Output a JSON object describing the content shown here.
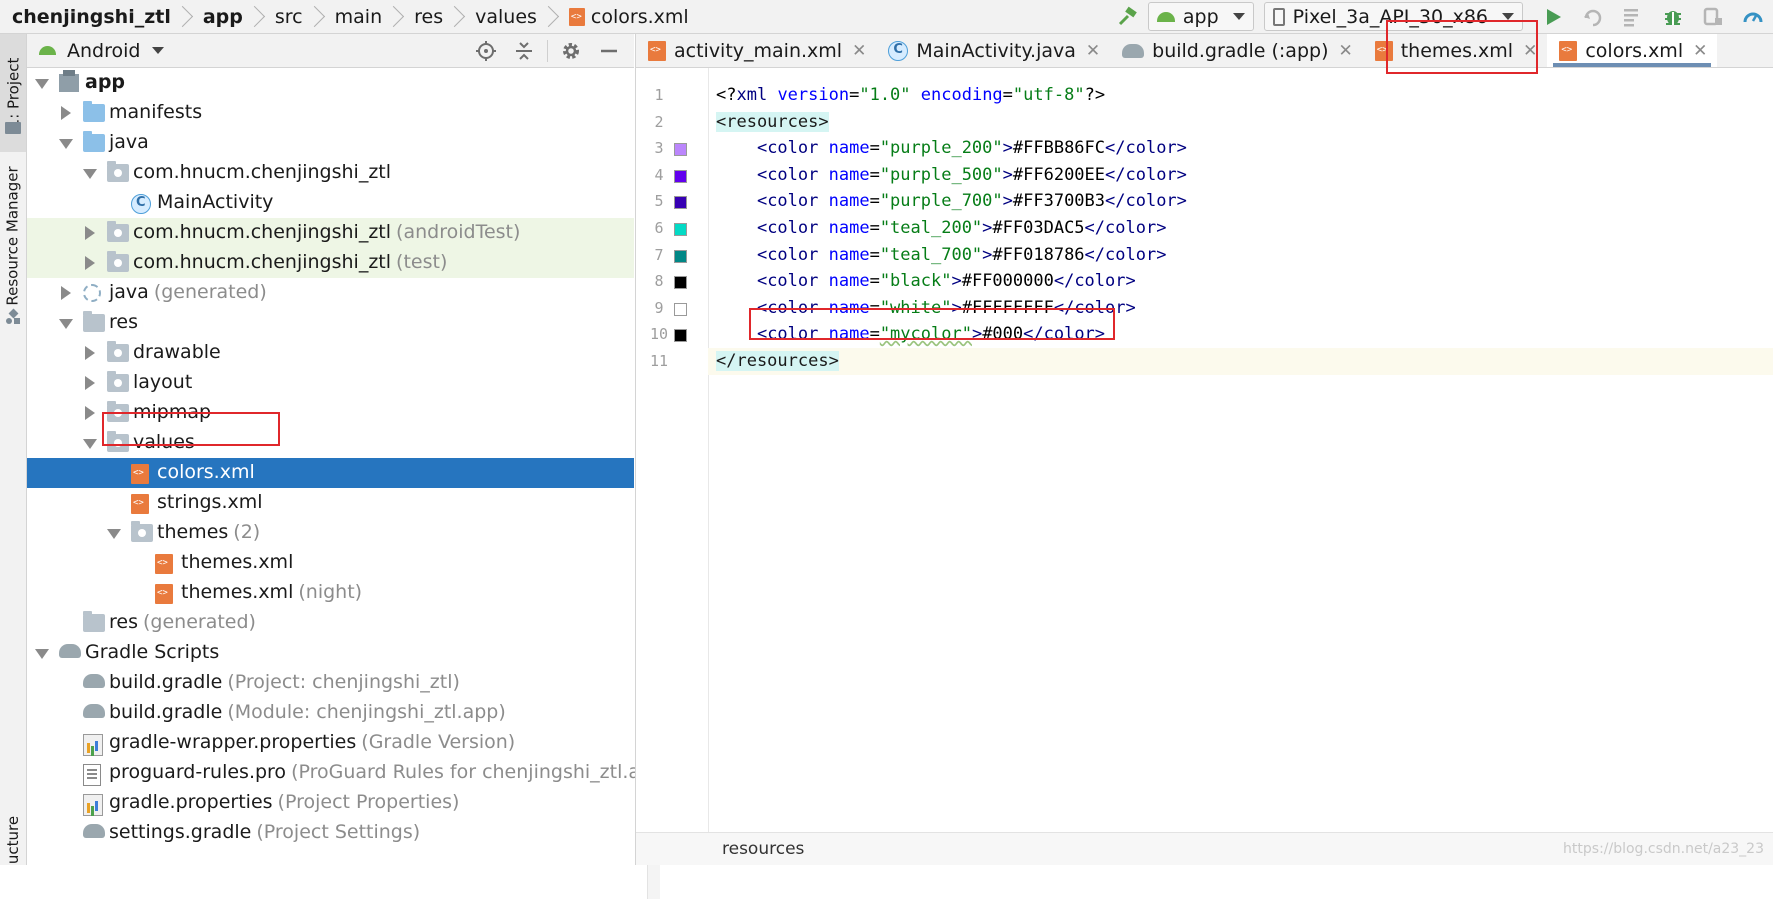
{
  "navbar": {
    "breadcrumbs": [
      "chenjingshi_ztl",
      "app",
      "src",
      "main",
      "res",
      "values",
      "colors.xml"
    ],
    "run_config": "app",
    "device": "Pixel_3a_API_30_x86"
  },
  "left_toolbar": {
    "tabs": [
      "1: Project",
      "Resource Manager",
      "ucture"
    ]
  },
  "project_panel": {
    "view_mode": "Android",
    "tree": [
      {
        "label": "app",
        "hint": "",
        "depth": 0,
        "toggle": "open",
        "icon": "module-icon",
        "bold": true
      },
      {
        "label": "manifests",
        "hint": "",
        "depth": 1,
        "toggle": "closed",
        "icon": "folder-icon"
      },
      {
        "label": "java",
        "hint": "",
        "depth": 1,
        "toggle": "open",
        "icon": "folder-icon"
      },
      {
        "label": "com.hnucm.chenjingshi_ztl",
        "hint": "",
        "depth": 2,
        "toggle": "open",
        "icon": "package-icon"
      },
      {
        "label": "MainActivity",
        "hint": "",
        "depth": 3,
        "toggle": "none",
        "icon": "class-icon"
      },
      {
        "label": "com.hnucm.chenjingshi_ztl",
        "hint": "(androidTest)",
        "depth": 2,
        "toggle": "closed",
        "icon": "package-icon",
        "green": true
      },
      {
        "label": "com.hnucm.chenjingshi_ztl",
        "hint": "(test)",
        "depth": 2,
        "toggle": "closed",
        "icon": "package-icon",
        "green": true
      },
      {
        "label": "java",
        "hint": "(generated)",
        "depth": 1,
        "toggle": "closed",
        "icon": "generated-icon"
      },
      {
        "label": "res",
        "hint": "",
        "depth": 1,
        "toggle": "open",
        "icon": "res-folder-icon"
      },
      {
        "label": "drawable",
        "hint": "",
        "depth": 2,
        "toggle": "closed",
        "icon": "package-icon"
      },
      {
        "label": "layout",
        "hint": "",
        "depth": 2,
        "toggle": "closed",
        "icon": "package-icon"
      },
      {
        "label": "mipmap",
        "hint": "",
        "depth": 2,
        "toggle": "closed",
        "icon": "package-icon"
      },
      {
        "label": "values",
        "hint": "",
        "depth": 2,
        "toggle": "open",
        "icon": "package-icon"
      },
      {
        "label": "colors.xml",
        "hint": "",
        "depth": 3,
        "toggle": "none",
        "icon": "xml-file-icon",
        "selected": true
      },
      {
        "label": "strings.xml",
        "hint": "",
        "depth": 3,
        "toggle": "none",
        "icon": "xml-file-icon"
      },
      {
        "label": "themes",
        "hint": "(2)",
        "depth": 3,
        "toggle": "open",
        "icon": "package-icon"
      },
      {
        "label": "themes.xml",
        "hint": "",
        "depth": 4,
        "toggle": "none",
        "icon": "xml-file-icon"
      },
      {
        "label": "themes.xml",
        "hint": "(night)",
        "depth": 4,
        "toggle": "none",
        "icon": "xml-file-icon"
      },
      {
        "label": "res",
        "hint": "(generated)",
        "depth": 1,
        "toggle": "none",
        "icon": "res-folder-icon"
      },
      {
        "label": "Gradle Scripts",
        "hint": "",
        "depth": 0,
        "toggle": "open",
        "icon": "gradle-icon"
      },
      {
        "label": "build.gradle",
        "hint": "(Project: chenjingshi_ztl)",
        "depth": 1,
        "toggle": "none",
        "icon": "gradle-icon"
      },
      {
        "label": "build.gradle",
        "hint": "(Module: chenjingshi_ztl.app)",
        "depth": 1,
        "toggle": "none",
        "icon": "gradle-icon"
      },
      {
        "label": "gradle-wrapper.properties",
        "hint": "(Gradle Version)",
        "depth": 1,
        "toggle": "none",
        "icon": "properties-icon"
      },
      {
        "label": "proguard-rules.pro",
        "hint": "(ProGuard Rules for chenjingshi_ztl.app)",
        "depth": 1,
        "toggle": "none",
        "icon": "text-file-icon"
      },
      {
        "label": "gradle.properties",
        "hint": "(Project Properties)",
        "depth": 1,
        "toggle": "none",
        "icon": "properties-icon"
      },
      {
        "label": "settings.gradle",
        "hint": "(Project Settings)",
        "depth": 1,
        "toggle": "none",
        "icon": "gradle-icon"
      }
    ]
  },
  "editor": {
    "tabs": [
      {
        "label": "activity_main.xml",
        "icon": "xml-file-icon",
        "active": false
      },
      {
        "label": "MainActivity.java",
        "icon": "class-icon",
        "active": false
      },
      {
        "label": "build.gradle (:app)",
        "icon": "gradle-icon",
        "active": false
      },
      {
        "label": "themes.xml",
        "icon": "xml-file-icon",
        "active": false
      },
      {
        "label": "colors.xml",
        "icon": "xml-file-icon",
        "active": true
      }
    ],
    "lines": [
      {
        "n": "1",
        "swatch": null,
        "tokens": [
          [
            "pi",
            "<?"
          ],
          [
            "tag",
            "xml "
          ],
          [
            "attr",
            "version"
          ],
          [
            "txt",
            "="
          ],
          [
            "val",
            "\"1.0\""
          ],
          [
            "txt",
            " "
          ],
          [
            "attr",
            "encoding"
          ],
          [
            "txt",
            "="
          ],
          [
            "val",
            "\"utf-8\""
          ],
          [
            "pi",
            "?>"
          ]
        ]
      },
      {
        "n": "2",
        "swatch": null,
        "tokens": [
          [
            "match",
            "<resources>"
          ]
        ]
      },
      {
        "n": "3",
        "swatch": "#BB86FC",
        "tokens": [
          [
            "txt",
            "    "
          ],
          [
            "tag",
            "<color "
          ],
          [
            "attr",
            "name"
          ],
          [
            "txt",
            "="
          ],
          [
            "val",
            "\"purple_200\""
          ],
          [
            "tag",
            ">"
          ],
          [
            "txt",
            "#FFBB86FC"
          ],
          [
            "tag",
            "</color>"
          ]
        ]
      },
      {
        "n": "4",
        "swatch": "#6200EE",
        "tokens": [
          [
            "txt",
            "    "
          ],
          [
            "tag",
            "<color "
          ],
          [
            "attr",
            "name"
          ],
          [
            "txt",
            "="
          ],
          [
            "val",
            "\"purple_500\""
          ],
          [
            "tag",
            ">"
          ],
          [
            "txt",
            "#FF6200EE"
          ],
          [
            "tag",
            "</color>"
          ]
        ]
      },
      {
        "n": "5",
        "swatch": "#3700B3",
        "tokens": [
          [
            "txt",
            "    "
          ],
          [
            "tag",
            "<color "
          ],
          [
            "attr",
            "name"
          ],
          [
            "txt",
            "="
          ],
          [
            "val",
            "\"purple_700\""
          ],
          [
            "tag",
            ">"
          ],
          [
            "txt",
            "#FF3700B3"
          ],
          [
            "tag",
            "</color>"
          ]
        ]
      },
      {
        "n": "6",
        "swatch": "#03DAC5",
        "tokens": [
          [
            "txt",
            "    "
          ],
          [
            "tag",
            "<color "
          ],
          [
            "attr",
            "name"
          ],
          [
            "txt",
            "="
          ],
          [
            "val",
            "\"teal_200\""
          ],
          [
            "tag",
            ">"
          ],
          [
            "txt",
            "#FF03DAC5"
          ],
          [
            "tag",
            "</color>"
          ]
        ]
      },
      {
        "n": "7",
        "swatch": "#018786",
        "tokens": [
          [
            "txt",
            "    "
          ],
          [
            "tag",
            "<color "
          ],
          [
            "attr",
            "name"
          ],
          [
            "txt",
            "="
          ],
          [
            "val",
            "\"teal_700\""
          ],
          [
            "tag",
            ">"
          ],
          [
            "txt",
            "#FF018786"
          ],
          [
            "tag",
            "</color>"
          ]
        ]
      },
      {
        "n": "8",
        "swatch": "#000000",
        "tokens": [
          [
            "txt",
            "    "
          ],
          [
            "tag",
            "<color "
          ],
          [
            "attr",
            "name"
          ],
          [
            "txt",
            "="
          ],
          [
            "val",
            "\"black\""
          ],
          [
            "tag",
            ">"
          ],
          [
            "txt",
            "#FF000000"
          ],
          [
            "tag",
            "</color>"
          ]
        ]
      },
      {
        "n": "9",
        "swatch": "#FFFFFF",
        "tokens": [
          [
            "txt",
            "    "
          ],
          [
            "tag",
            "<color "
          ],
          [
            "attr",
            "name"
          ],
          [
            "txt",
            "="
          ],
          [
            "val",
            "\"white\""
          ],
          [
            "tag",
            ">"
          ],
          [
            "txt",
            "#FFFFFFFF"
          ],
          [
            "tag",
            "</color>"
          ]
        ]
      },
      {
        "n": "10",
        "swatch": "#000000",
        "tokens": [
          [
            "txt",
            "    "
          ],
          [
            "tag",
            "<color "
          ],
          [
            "attr",
            "name"
          ],
          [
            "txt",
            "="
          ],
          [
            "val",
            "\"mycolor\""
          ],
          [
            "tag",
            ">"
          ],
          [
            "txt",
            "#000"
          ],
          [
            "tag",
            "</color>"
          ]
        ]
      },
      {
        "n": "11",
        "swatch": null,
        "tokens": [
          [
            "match",
            "</resources>"
          ]
        ],
        "highlight": true
      }
    ]
  },
  "statusbar": {
    "breadcrumb": "resources"
  },
  "watermark": "https://blog.csdn.net/a23_23",
  "colors": {
    "selection": "#2675bf",
    "highlight_box": "#e0272b",
    "test_source_bg": "#eef6e5"
  }
}
